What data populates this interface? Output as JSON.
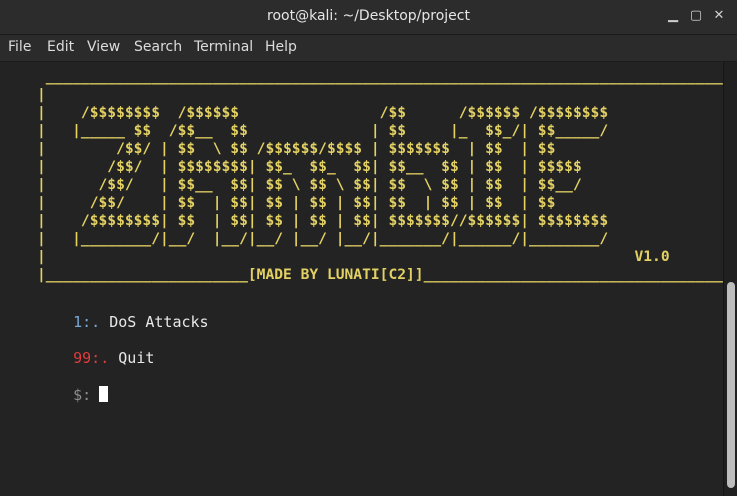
{
  "window": {
    "title": "root@kali: ~/Desktop/project"
  },
  "controls": {
    "minimize": "▁",
    "maximize": "▢",
    "close": "✕"
  },
  "menu": [
    "File",
    "Edit",
    "View",
    "Search",
    "Terminal",
    "Help"
  ],
  "banner": {
    "art": " ______________________________________________________________________________\n|                                                                              |\n|    /$$$$$$$$  /$$$$$$                /$$      /$$$$$$ /$$$$$$$$               |\n|   |_____ $$  /$$__  $$              | $$     |_  $$_/| $$_____/               |\n|        /$$/ | $$  \\ $$ /$$$$$$/$$$$ | $$$$$$$  | $$  | $$                   |\n|       /$$/  | $$$$$$$$| $$_  $$_  $$| $$__  $$ | $$  | $$$$$                |\n|      /$$/   | $$__  $$| $$ \\ $$ \\ $$| $$  \\ $$ | $$  | $$__/                |\n|     /$$/    | $$  | $$| $$ | $$ | $$| $$  | $$ | $$  | $$                   |\n|    /$$$$$$$$| $$  | $$| $$ | $$ | $$| $$$$$$$//$$$$$$| $$$$$$$$             |\n|   |________/|__/  |__/|__/ |__/ |__/|_______/|______/|________/             |\n|                                                                   V1.0       |\n|_______________________[MADE BY LUNATI[C2]]___________________________________|"
  },
  "options": [
    {
      "key": "1:.",
      "label": "DoS Attacks"
    },
    {
      "key": "99:.",
      "label": "Quit"
    }
  ],
  "prompt": "$:"
}
